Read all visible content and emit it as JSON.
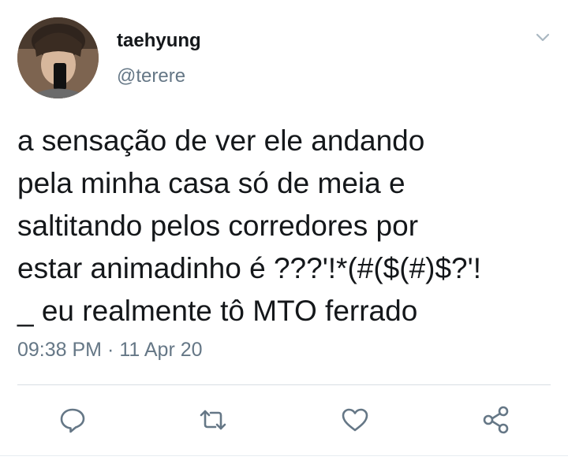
{
  "tweet": {
    "display_name": "taehyung",
    "handle": "@terere",
    "text_lines": [
      "a sensação de ver ele andando",
      "pela minha casa só de meia e",
      "saltitando pelos corredores por",
      "estar animadinho é ???'!*(#($(#)$?'!",
      "_ eu realmente tô MTO ferrado"
    ],
    "time": "09:38 PM",
    "separator": "·",
    "date": "11 Apr 20"
  },
  "icons": {
    "menu": "chevron-down-icon",
    "reply": "reply-icon",
    "retweet": "retweet-icon",
    "like": "heart-icon",
    "share": "share-icon"
  },
  "colors": {
    "text": "#14171a",
    "secondary": "#657786",
    "icon": "#657786",
    "divider": "#d8dee3",
    "chevron": "#aab8c2"
  }
}
